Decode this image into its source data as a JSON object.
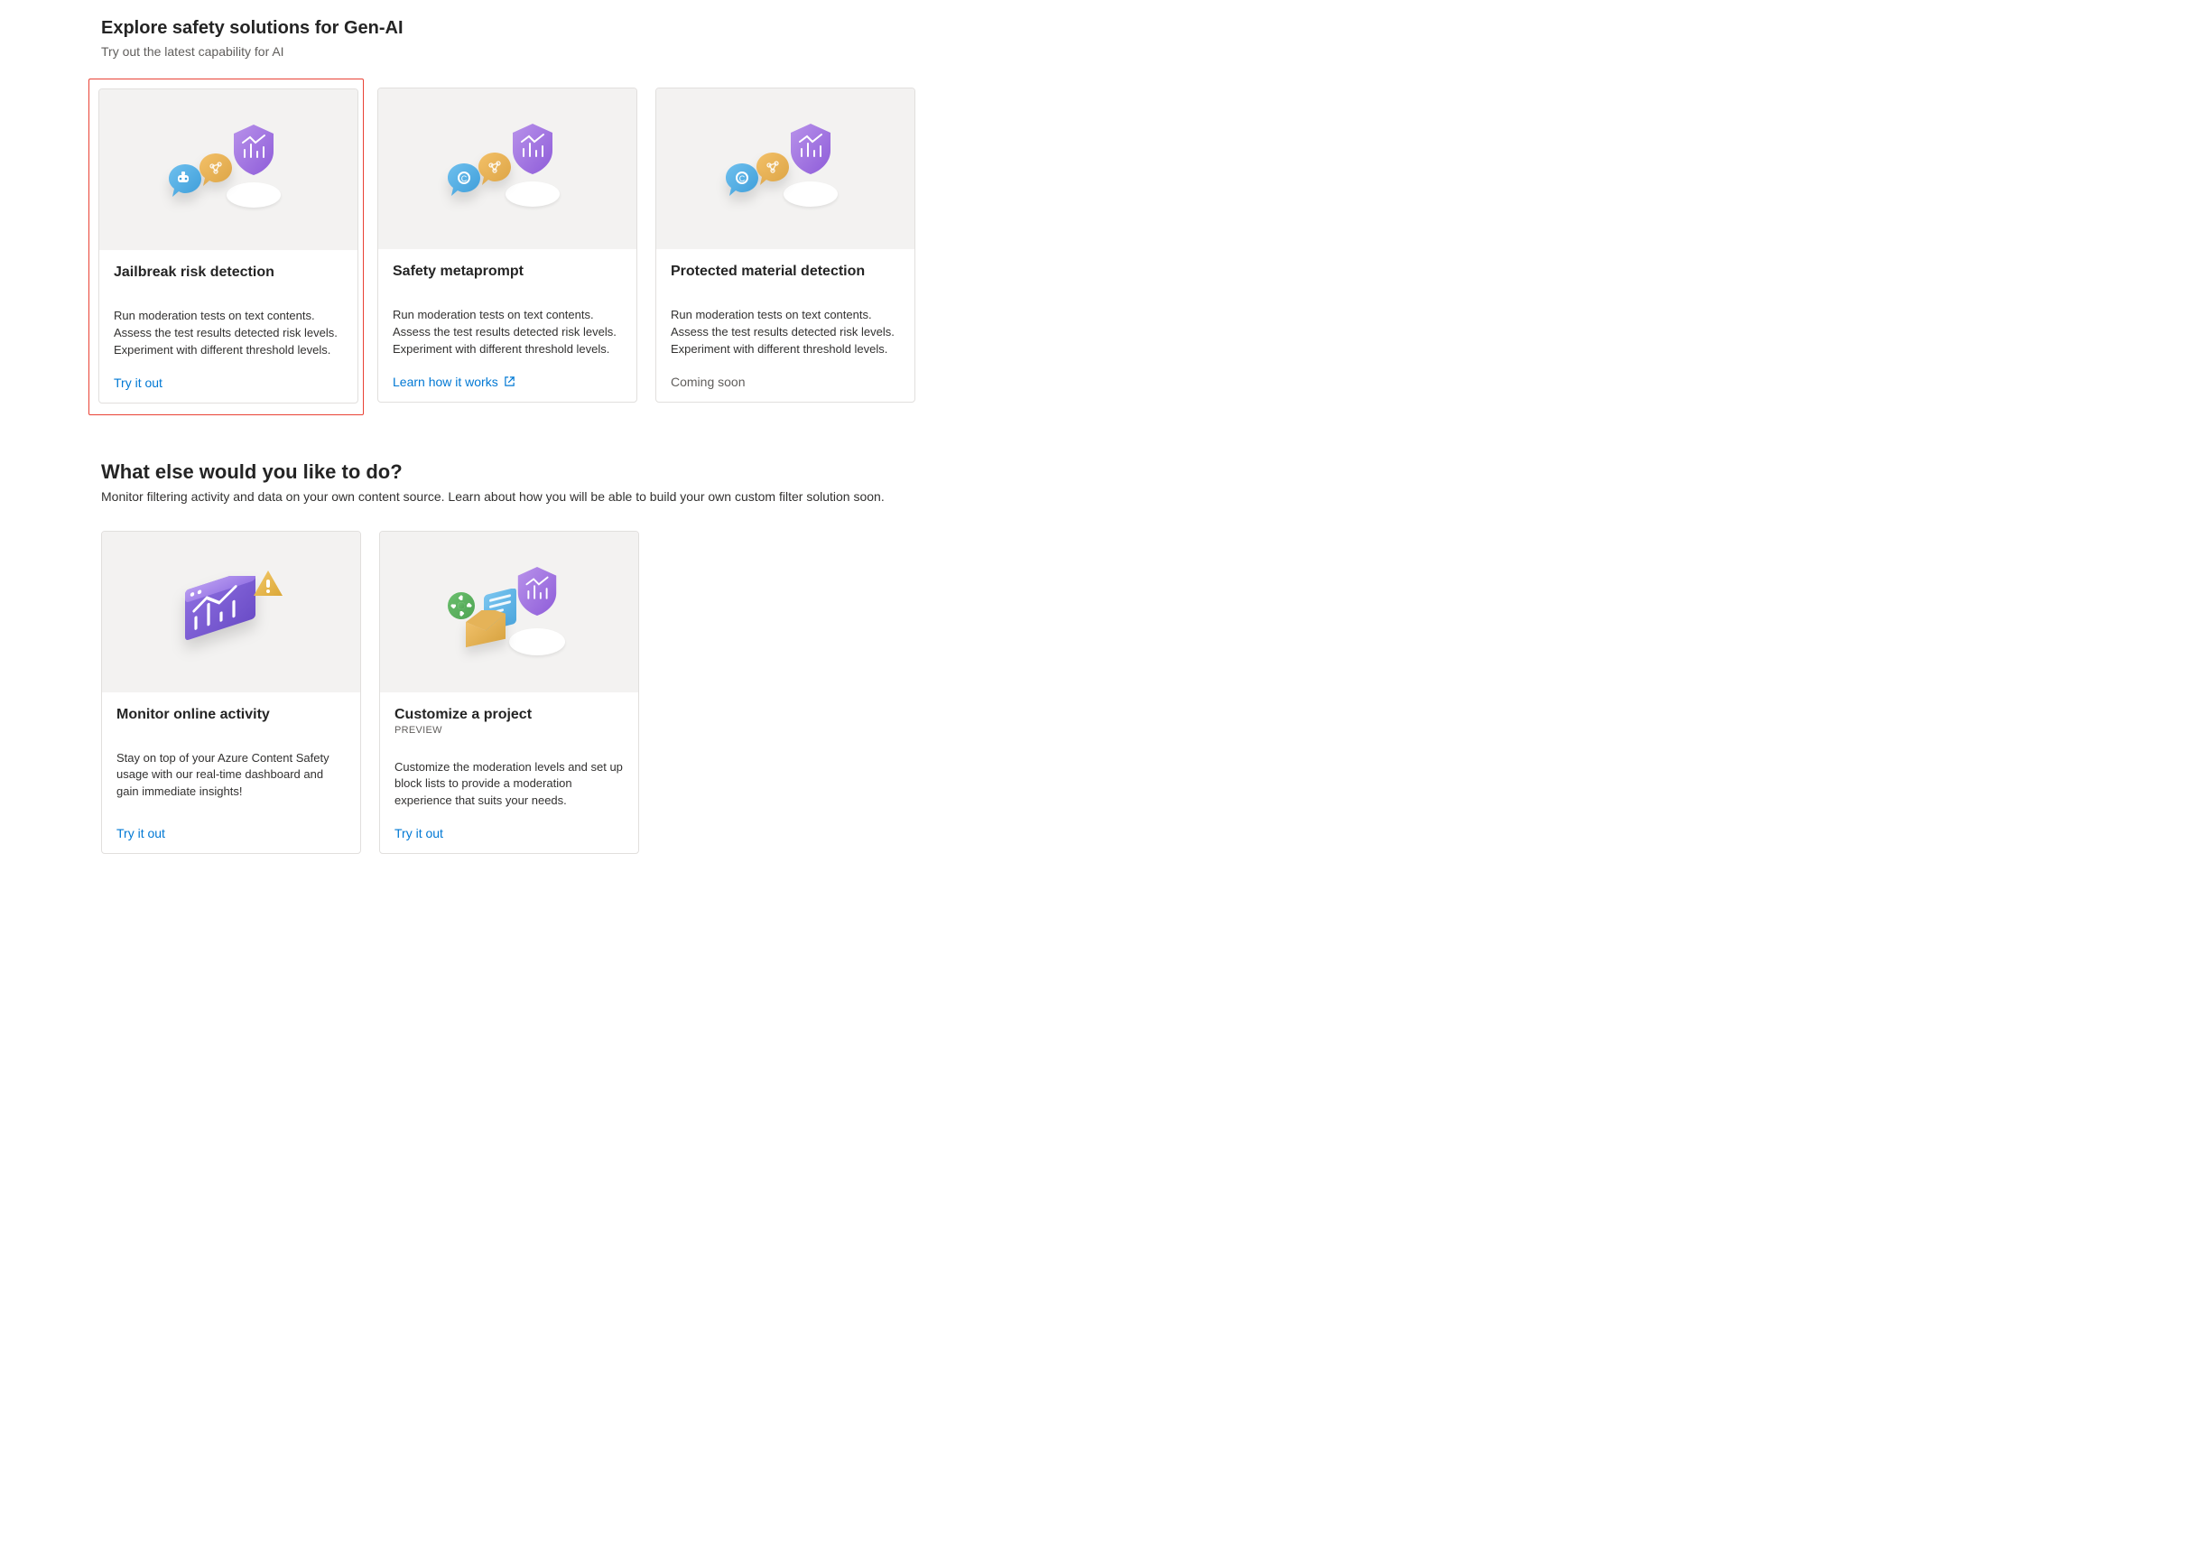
{
  "section1": {
    "title": "Explore safety solutions for Gen-AI",
    "subtitle": "Try out the latest capability for AI",
    "cards": [
      {
        "title": "Jailbreak risk detection",
        "desc": "Run moderation tests on text contents. Assess the test results detected risk levels. Experiment with different threshold levels.",
        "link": "Try it out",
        "link_type": "link",
        "highlighted": true,
        "inner_icon": "robot"
      },
      {
        "title": "Safety metaprompt",
        "desc": "Run moderation tests on text contents. Assess the test results detected risk levels. Experiment with different threshold levels.",
        "link": "Learn how it works",
        "link_type": "external",
        "highlighted": false,
        "inner_icon": "copyright"
      },
      {
        "title": "Protected material detection",
        "desc": "Run moderation tests on text contents. Assess the test results detected risk levels. Experiment with different threshold levels.",
        "link": "Coming soon",
        "link_type": "disabled",
        "highlighted": false,
        "inner_icon": "copyright"
      }
    ]
  },
  "section2": {
    "title": "What else would you like to do?",
    "subtitle": "Monitor filtering activity and data on your own content source. Learn about how you will be able to build your own custom filter solution soon.",
    "cards": [
      {
        "title": "Monitor online activity",
        "tag": "",
        "desc": "Stay on top of your Azure Content Safety usage with our real-time dashboard and gain immediate insights!",
        "link": "Try it out",
        "link_type": "link",
        "icon": "monitor"
      },
      {
        "title": "Customize a project",
        "tag": "PREVIEW",
        "desc": "Customize the moderation levels and set up block lists to provide a moderation experience that suits your needs.",
        "link": "Try it out",
        "link_type": "link",
        "icon": "customize"
      }
    ]
  }
}
